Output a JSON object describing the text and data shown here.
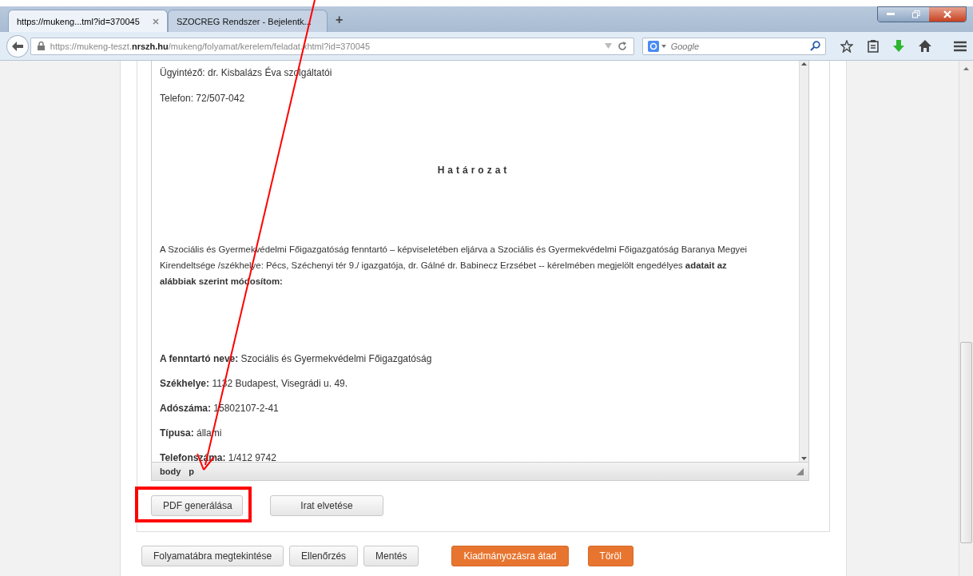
{
  "browser": {
    "tabs": [
      {
        "title": "https://mukeng...tml?id=370045",
        "selected": true
      },
      {
        "title": "SZOCREG Rendszer - Bejelentk...",
        "selected": false
      }
    ],
    "new_tab": "+",
    "url": "https://mukeng-teszt.**nrszh.hu**/mukeng/folyamat/kerelem/feladat.xhtml?id=370045",
    "search": {
      "placeholder": "Google"
    }
  },
  "editor": {
    "lines": [
      {
        "kind": "text",
        "text": "Ügyintéző: dr. Kisbalázs Éva szolgáltatói"
      },
      {
        "kind": "text",
        "text": "Telefon: 72/507-042"
      },
      {
        "kind": "heading",
        "text": "Határozat"
      },
      {
        "kind": "paragraph",
        "text": "A Szociális és Gyermekvédelmi Főigazgatóság fenntartó – képviseletében eljárva a Szociális és Gyermekvédelmi Főigazgatóság Baranya Megyei Kirendeltsége /székhelye: Pécs, Széchenyi tér 9./ igazgatója, dr. Gálné dr. Babinecz Erzsébet -- kérelmében megjelölt engedélyes **adatait az alábbiak szerint módosítom:**"
      },
      {
        "kind": "field",
        "label": "A fenntartó neve:",
        "value": "Szociális és Gyermekvédelmi Főigazgatóság"
      },
      {
        "kind": "field",
        "label": "Székhelye:",
        "value": "1132 Budapest, Visegrádi u. 49."
      },
      {
        "kind": "field",
        "label": "Adószáma:",
        "value": "15802107-2-41"
      },
      {
        "kind": "field",
        "label": "Típusa:",
        "value": "állami"
      },
      {
        "kind": "field",
        "label": "Telefonszáma:",
        "value": "1/412 9742"
      }
    ],
    "path": [
      "body",
      "p"
    ]
  },
  "editor_buttons": [
    "PDF generálása",
    "Irat elvetése"
  ],
  "actions": [
    {
      "label": "Folyamatábra megtekintése",
      "kind": "default"
    },
    {
      "label": "Ellenőrzés",
      "kind": "default"
    },
    {
      "label": "Mentés",
      "kind": "default"
    },
    {
      "label": "Kiadmányozásra átad",
      "kind": "primary"
    },
    {
      "label": "Töröl",
      "kind": "primary"
    }
  ]
}
